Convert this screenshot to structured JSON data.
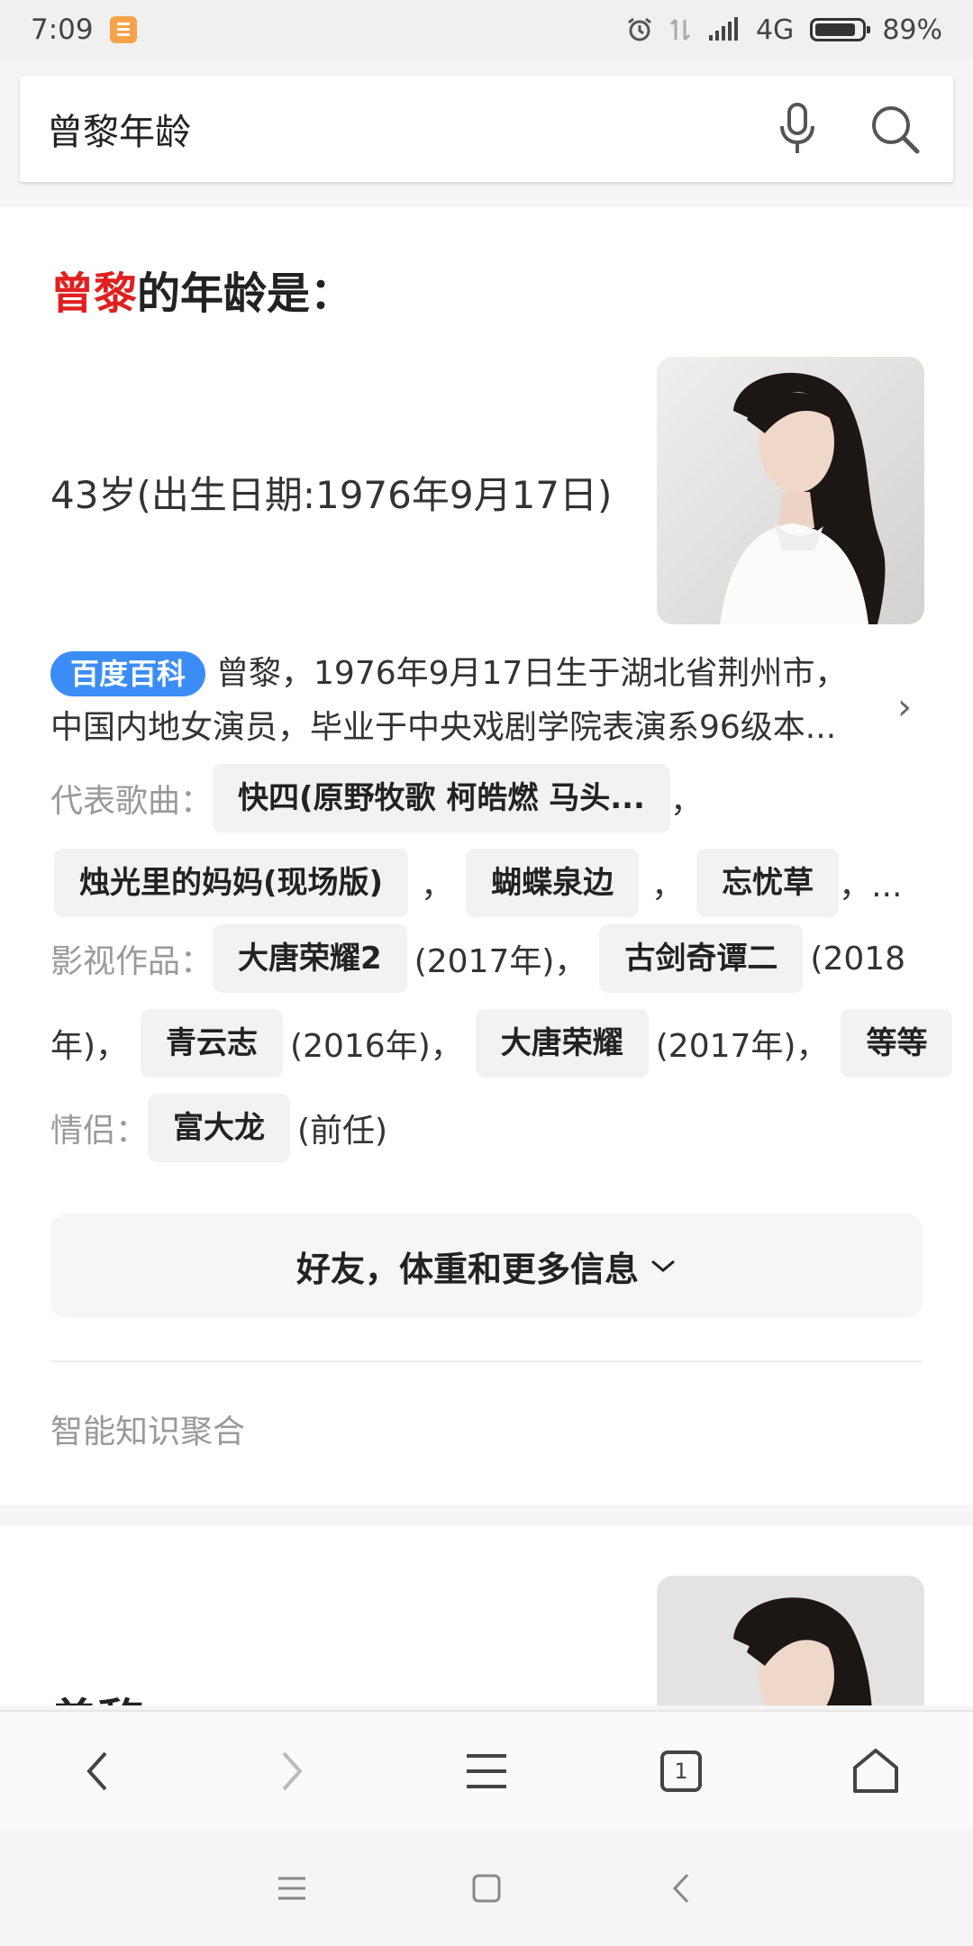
{
  "status_bar": {
    "time": "7:09",
    "network": "4G",
    "battery": "89%",
    "icons": [
      "notes-app-icon",
      "alarm-icon",
      "data-arrows-icon",
      "signal-icon",
      "battery-icon"
    ]
  },
  "search": {
    "query": "曾黎年龄",
    "icons": [
      "microphone-icon",
      "search-icon"
    ]
  },
  "answer": {
    "title_highlight": "曾黎",
    "title_rest": "的年龄是：",
    "value": "43岁(出生日期:1976年9月17日)",
    "baike_badge": "百度百科",
    "intro": "曾黎，1976年9月17日生于湖北省荆州市，中国内地女演员，毕业于中央戏剧学院表演系96级本..."
  },
  "songs": {
    "label": "代表歌曲：",
    "items": [
      "快四(原野牧歌 柯皓燃 马头...",
      "烛光里的妈妈(现场版)",
      "蝴蝶泉边",
      "忘忧草"
    ],
    "sep": "，",
    "ellipsis": "，..."
  },
  "works": {
    "label": "影视作品：",
    "items": [
      {
        "title": "大唐荣耀2",
        "year": "(2017年)，"
      },
      {
        "title": "古剑奇谭二",
        "year": "(2018"
      },
      {
        "title": "青云志",
        "year": "(2016年)，"
      },
      {
        "title": "大唐荣耀",
        "year": "(2017年)，"
      }
    ],
    "year_cont": "年)，",
    "more": "等等"
  },
  "partner": {
    "label": "情侣：",
    "name": "富大龙",
    "note": "(前任)"
  },
  "more_button": "好友，体重和更多信息",
  "footer_label": "智能知识聚合",
  "card2": {
    "name": "曾黎"
  },
  "toolbar": {
    "tab_count": "1"
  }
}
